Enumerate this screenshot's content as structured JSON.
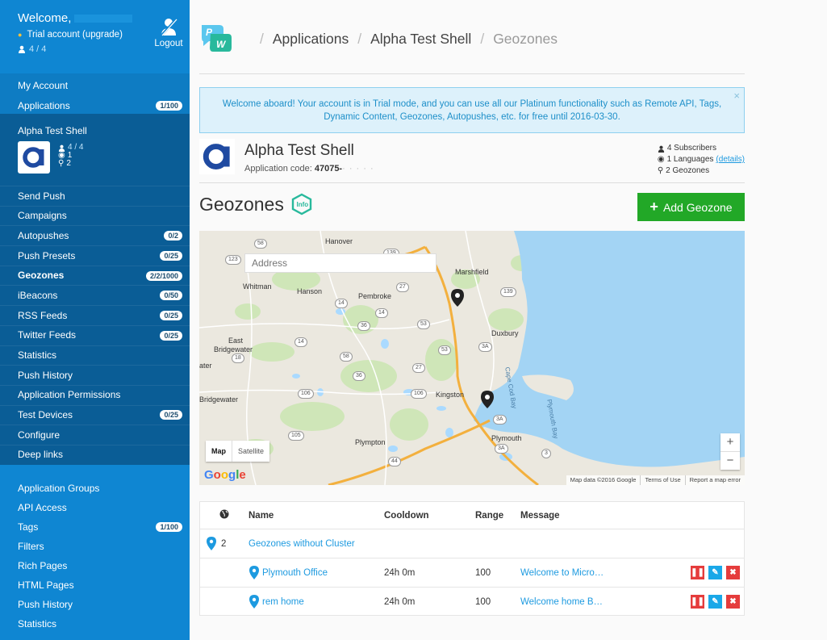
{
  "sidebar": {
    "welcome": "Welcome,",
    "trial": "Trial account (upgrade)",
    "users": "4 / 4",
    "logout": "Logout",
    "top_items": [
      {
        "label": "My Account",
        "badge": ""
      },
      {
        "label": "Applications",
        "badge": "1/100"
      }
    ],
    "app": {
      "name": "Alpha Test Shell",
      "users": "4 / 4",
      "languages": "1",
      "geozones": "2"
    },
    "items": [
      {
        "label": "Send Push",
        "badge": ""
      },
      {
        "label": "Campaigns",
        "badge": ""
      },
      {
        "label": "Autopushes",
        "badge": "0/2"
      },
      {
        "label": "Push Presets",
        "badge": "0/25"
      },
      {
        "label": "Geozones",
        "badge": "2/2/1000"
      },
      {
        "label": "iBeacons",
        "badge": "0/50"
      },
      {
        "label": "RSS Feeds",
        "badge": "0/25"
      },
      {
        "label": "Twitter Feeds",
        "badge": "0/25"
      },
      {
        "label": "Statistics",
        "badge": ""
      },
      {
        "label": "Push History",
        "badge": ""
      },
      {
        "label": "Application Permissions",
        "badge": ""
      },
      {
        "label": "Test Devices",
        "badge": "0/25"
      },
      {
        "label": "Configure",
        "badge": ""
      },
      {
        "label": "Deep links",
        "badge": ""
      }
    ],
    "bottom_items": [
      {
        "label": "Application Groups",
        "badge": ""
      },
      {
        "label": "API Access",
        "badge": ""
      },
      {
        "label": "Tags",
        "badge": "1/100"
      },
      {
        "label": "Filters",
        "badge": ""
      },
      {
        "label": "Rich Pages",
        "badge": ""
      },
      {
        "label": "HTML Pages",
        "badge": ""
      },
      {
        "label": "Push History",
        "badge": ""
      },
      {
        "label": "Statistics",
        "badge": ""
      }
    ]
  },
  "breadcrumb": [
    "Applications",
    "Alpha Test Shell",
    "Geozones"
  ],
  "alert": "Welcome aboard! Your account is in Trial mode, and you can use all our Platinum functionality such as Remote API, Tags, Dynamic Content, Geozones, Autopushes, etc. for free until 2016-03-30.",
  "alert_close": "×",
  "app_header": {
    "name": "Alpha Test Shell",
    "code_label": "Application code:",
    "code_value": "47075-",
    "subscribers": "4 Subscribers",
    "languages": "1 Languages",
    "details": "(details)",
    "geozones": "2 Geozones"
  },
  "section_title": "Geozones",
  "add_button": "Add Geozone",
  "map": {
    "search_placeholder": "Address",
    "type_map": "Map",
    "type_satellite": "Satellite",
    "zoom_in": "+",
    "zoom_out": "−",
    "google": [
      "G",
      "o",
      "o",
      "g",
      "l",
      "e"
    ],
    "google_colors": [
      "#4285f4",
      "#ea4335",
      "#fbbc05",
      "#4285f4",
      "#34a853",
      "#ea4335"
    ],
    "attribution": [
      "Map data ©2016 Google",
      "Terms of Use",
      "Report a map error"
    ],
    "places": [
      "Hanover",
      "Marshfield",
      "Whitman",
      "Hanson",
      "Pembroke",
      "Duxbury",
      "East",
      "Bridgewater",
      "ater",
      "Bridgewater",
      "Kingston",
      "Plympton",
      "Plymouth",
      "Cape Cod Bay",
      "Plymouth Bay"
    ],
    "routes": [
      "58",
      "123",
      "139",
      "139",
      "14",
      "27",
      "36",
      "14",
      "53",
      "14",
      "18",
      "58",
      "3A",
      "53",
      "27",
      "36",
      "106",
      "106",
      "105",
      "44",
      "3A",
      "3A",
      "3"
    ]
  },
  "table": {
    "headers": {
      "name": "Name",
      "cooldown": "Cooldown",
      "range": "Range",
      "message": "Message"
    },
    "group": {
      "count": "2",
      "name": "Geozones without Cluster"
    },
    "rows": [
      {
        "name": "Plymouth Office",
        "cooldown": "24h 0m",
        "range": "100",
        "message": "Welcome to Micro…"
      },
      {
        "name": "rem home",
        "cooldown": "24h 0m",
        "range": "100",
        "message": "Welcome home B…"
      }
    ]
  },
  "colors": {
    "sidebar": "#0f86d2",
    "accent": "#1d9ae0",
    "add_button": "#22a827",
    "delete": "#e53c3c"
  }
}
